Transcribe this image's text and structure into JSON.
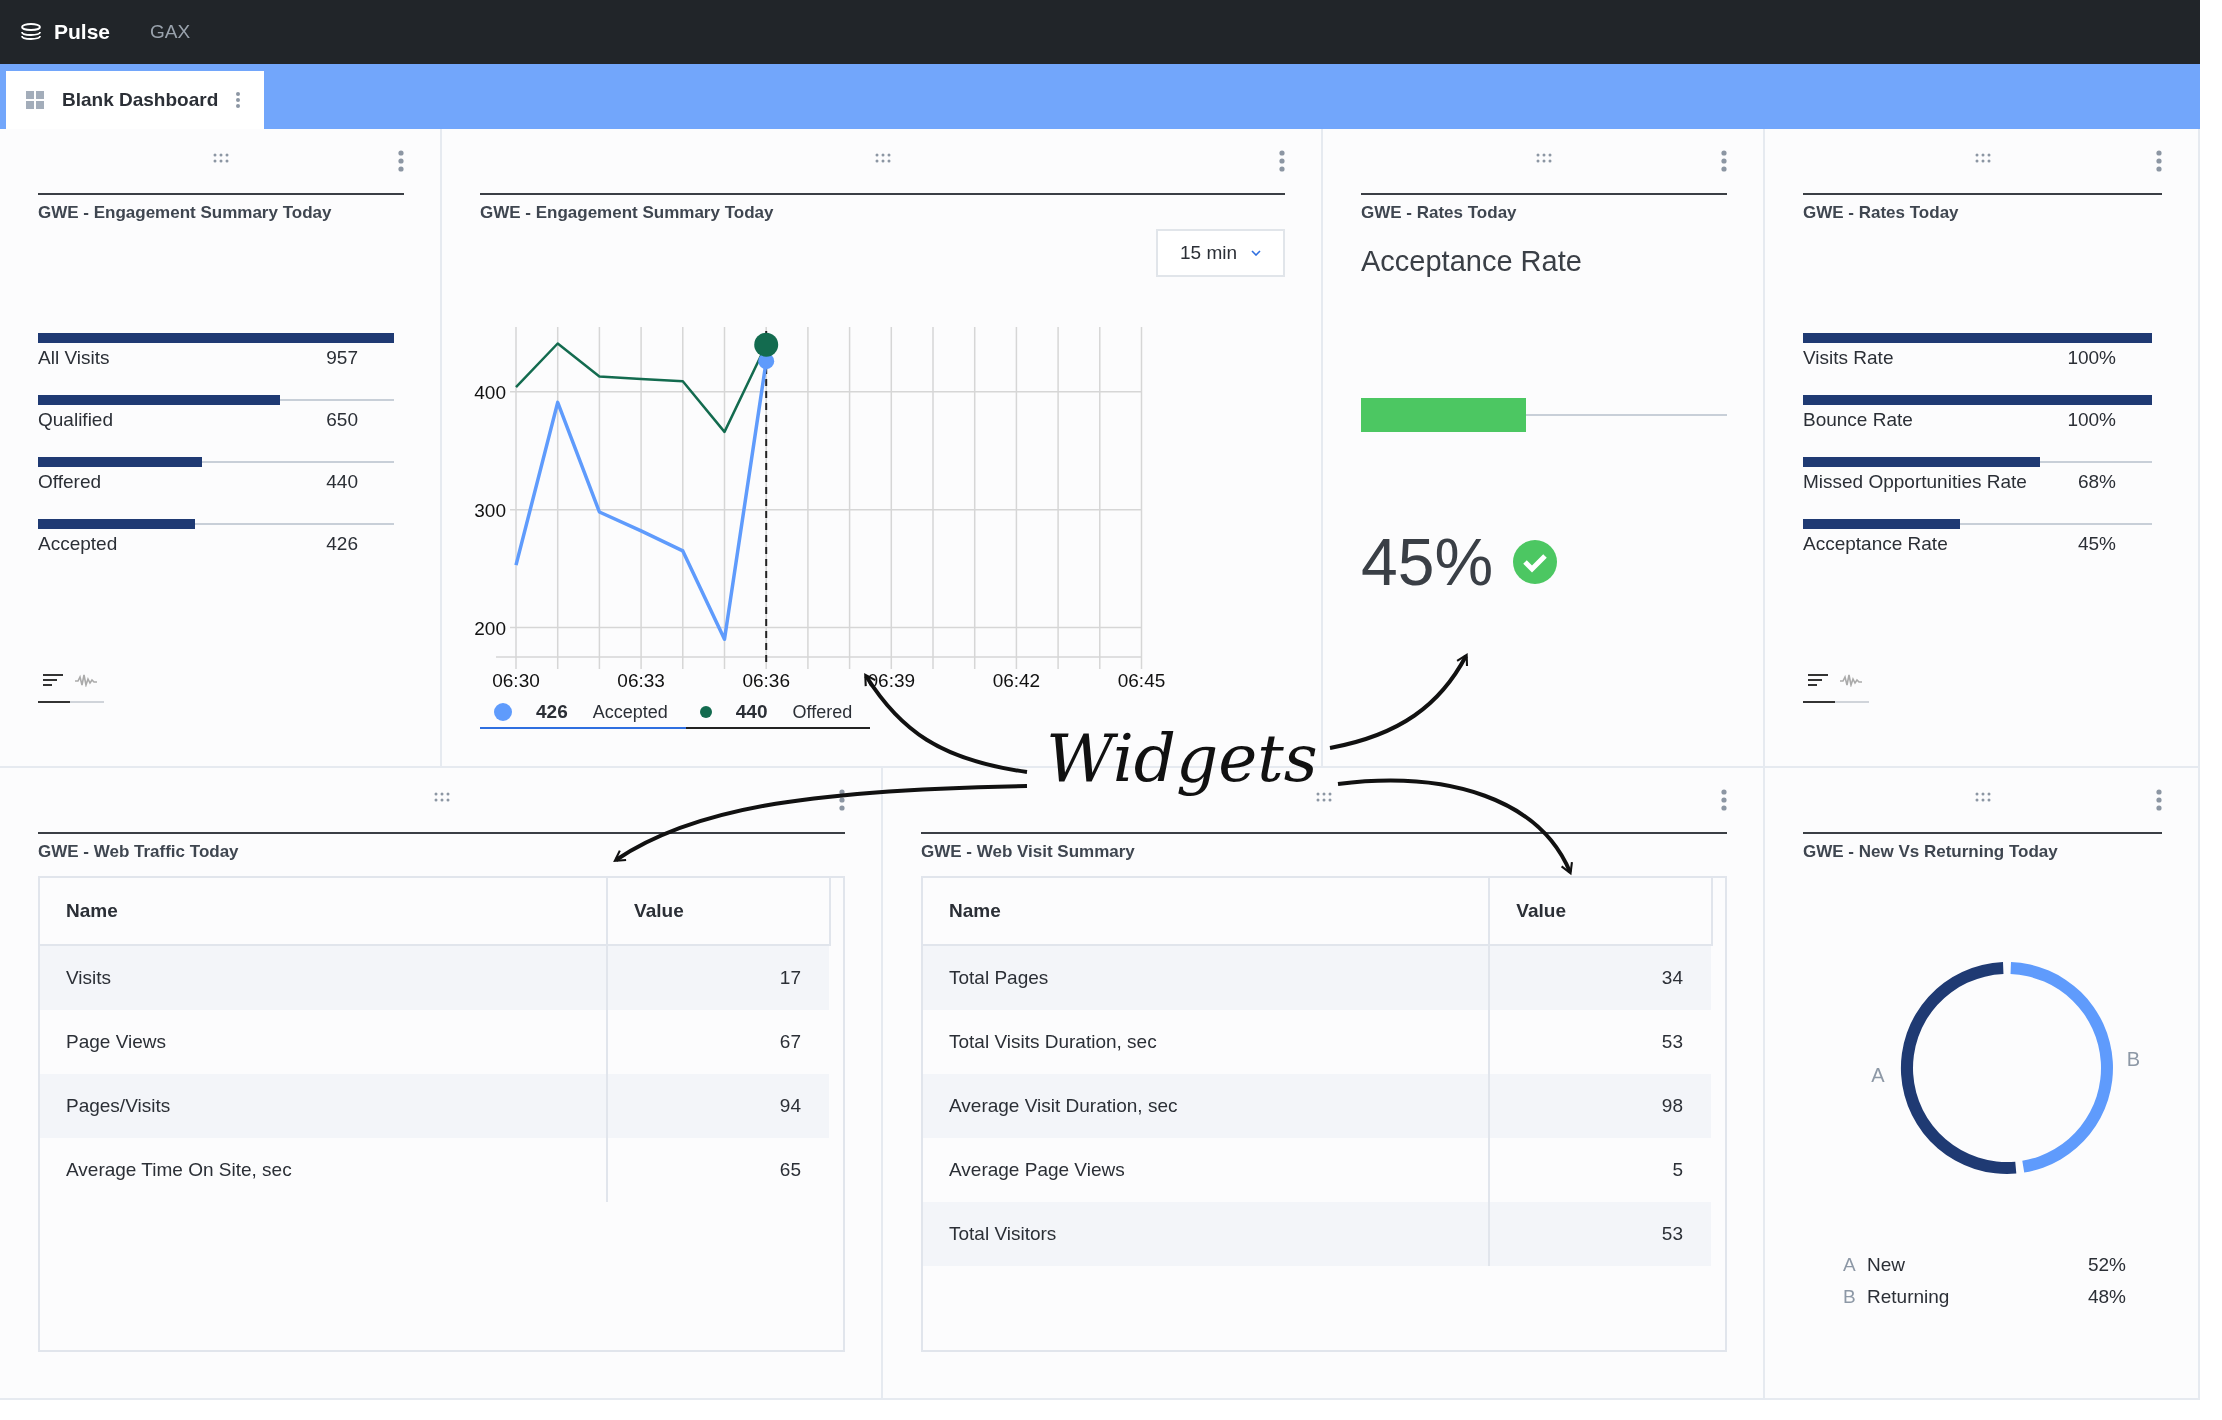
{
  "app_bar": {
    "brand": "Pulse",
    "nav_item": "GAX"
  },
  "dashboard_tab": {
    "label": "Blank Dashboard",
    "selected": true
  },
  "rows": [
    {
      "widgets": [
        {
          "kind": "bars",
          "title": "GWE - Engagement Summary Today",
          "bars": [
            {
              "label": "All Visits",
              "value": "957",
              "level": 1
            },
            {
              "label": "Qualified",
              "value": "650",
              "level": 0.68
            },
            {
              "label": "Offered",
              "value": "440",
              "level": 0.46
            },
            {
              "label": "Accepted",
              "value": "426",
              "level": 0.44
            }
          ],
          "view_tabs": [
            {
              "kind": "bars",
              "selected": true
            },
            {
              "kind": "wave",
              "selected": false
            }
          ]
        },
        {
          "kind": "line_chart",
          "title": "GWE - Engagement Summary Today",
          "interval": "15 min",
          "chart_data": {
            "type": "line",
            "categories": [
              "06:30",
              null,
              null,
              "06:33",
              null,
              null,
              "06:36",
              null,
              null,
              "06:39",
              null,
              null,
              "06:42",
              null,
              null,
              "06:45"
            ],
            "ylim": [
              175,
              455
            ],
            "grid": true,
            "yticks": [
              200,
              300,
              400
            ],
            "series": [
              {
                "name": "Accepted",
                "color": "#5f9bfc",
                "values": [
                  253,
                  391,
                  298,
                  282,
                  265,
                  190,
                  426,
                  null,
                  null,
                  null,
                  null,
                  null,
                  null,
                  null,
                  null,
                  null
                ]
              },
              {
                "name": "Offered",
                "color": "#136b4f",
                "values": [
                  404,
                  441,
                  413,
                  411,
                  409,
                  366,
                  440,
                  null,
                  null,
                  null,
                  null,
                  null,
                  null,
                  null,
                  null,
                  null
                ]
              }
            ]
          },
          "legend": [
            {
              "value": "426"
            },
            {
              "value": "440"
            }
          ]
        },
        {
          "kind": "kpi",
          "title": "GWE - Rates Today",
          "metric": "Acceptance Rate",
          "level": 0.45,
          "value": "45%"
        },
        {
          "kind": "bars",
          "title": "GWE - Rates Today",
          "bars": [
            {
              "label": "Visits Rate",
              "value": "100%",
              "level": 1
            },
            {
              "label": "Bounce Rate",
              "value": "100%",
              "level": 1
            },
            {
              "label": "Missed Opportunities Rate",
              "value": "68%",
              "level": 0.68
            },
            {
              "label": "Acceptance Rate",
              "value": "45%",
              "level": 0.45
            }
          ],
          "view_tabs": [
            {
              "kind": "bars",
              "selected": true
            },
            {
              "kind": "wave",
              "selected": false
            }
          ]
        }
      ]
    },
    {
      "widgets": [
        {
          "kind": "table",
          "title": "GWE - Web Traffic Today",
          "columns": [
            "Name",
            "Value"
          ],
          "rows": [
            [
              "Visits",
              "17"
            ],
            [
              "Page Views",
              "67"
            ],
            [
              "Pages/Visits",
              "94"
            ],
            [
              "Average Time On Site, sec",
              "65"
            ]
          ]
        },
        {
          "kind": "table",
          "title": "GWE - Web Visit Summary",
          "columns": [
            "Name",
            "Value"
          ],
          "rows": [
            [
              "Total Pages",
              "34"
            ],
            [
              "Total Visits Duration, sec",
              "53"
            ],
            [
              "Average Visit Duration, sec",
              "98"
            ],
            [
              "Average Page Views",
              "5"
            ],
            [
              "Total Visitors",
              "53"
            ]
          ]
        },
        {
          "kind": "donut",
          "title": "GWE - New Vs Returning Today",
          "chart_data": {
            "type": "donut",
            "categories": [
              "New",
              "Returning"
            ],
            "values": [
              52,
              48
            ],
            "colors": [
              "#1f3a73",
              "#5f9bfc"
            ]
          },
          "slice_labels": [
            "A",
            "B"
          ],
          "legend": [
            {
              "marker": "A",
              "value": "52%"
            },
            {
              "marker": "B",
              "value": "48%"
            }
          ]
        }
      ]
    }
  ],
  "annotation": {
    "text": "Widgets"
  }
}
